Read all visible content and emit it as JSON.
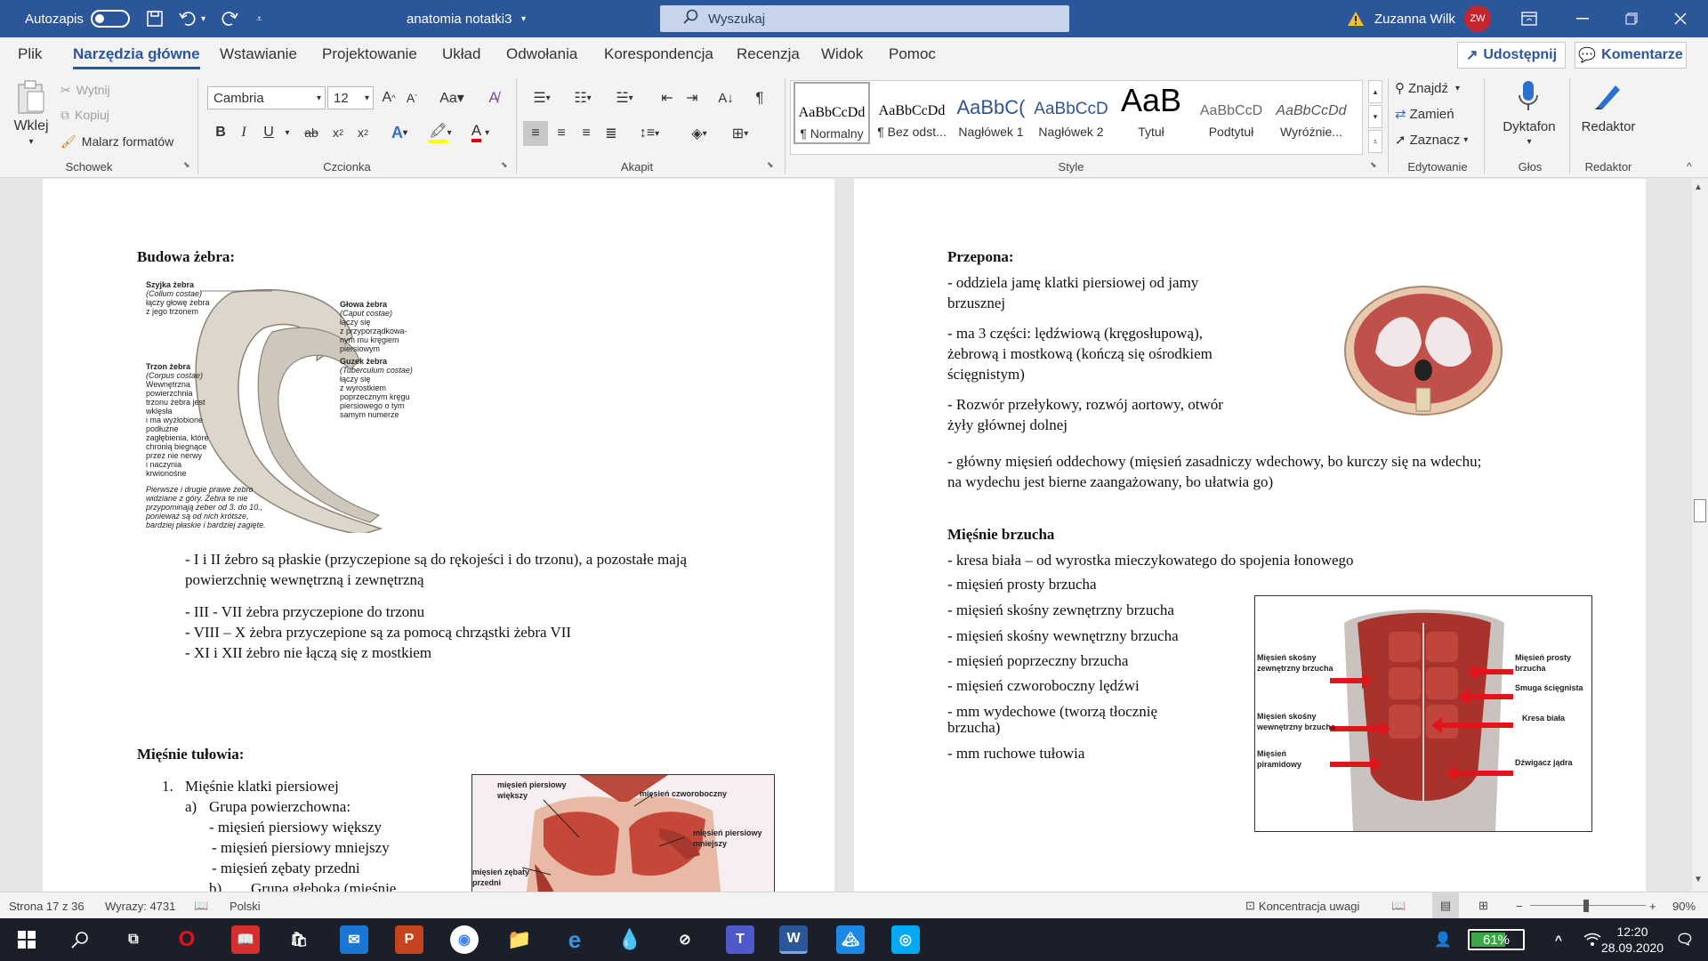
{
  "titlebar": {
    "autosave_label": "Autozapis",
    "doc_title": "anatomia notatki3",
    "search_placeholder": "Wyszukaj",
    "user_name": "Zuzanna Wilk",
    "user_initials": "ZW"
  },
  "menu": {
    "tabs": [
      "Plik",
      "Narzędzia główne",
      "Wstawianie",
      "Projektowanie",
      "Układ",
      "Odwołania",
      "Korespondencja",
      "Recenzja",
      "Widok",
      "Pomoc"
    ],
    "share": "Udostępnij",
    "comments": "Komentarze"
  },
  "ribbon": {
    "clipboard": {
      "paste": "Wklej",
      "cut": "Wytnij",
      "copy": "Kopiuj",
      "format_painter": "Malarz formatów",
      "label": "Schowek"
    },
    "font": {
      "name": "Cambria",
      "size": "12",
      "label": "Czcionka"
    },
    "paragraph": {
      "label": "Akapit"
    },
    "styles": {
      "label": "Style",
      "items": [
        {
          "preview": "AaBbCcDd",
          "name": "¶ Normalny"
        },
        {
          "preview": "AaBbCcDd",
          "name": "¶ Bez odst..."
        },
        {
          "preview": "AaBbC(",
          "name": "Nagłówek 1"
        },
        {
          "preview": "AaBbCcD",
          "name": "Nagłówek 2"
        },
        {
          "preview": "AaB",
          "name": "Tytuł"
        },
        {
          "preview": "AaBbCcD",
          "name": "Podtytuł"
        },
        {
          "preview": "AaBbCcDd",
          "name": "Wyróżnie..."
        }
      ]
    },
    "editing": {
      "find": "Znajdź",
      "replace": "Zamień",
      "select": "Zaznacz",
      "label": "Edytowanie"
    },
    "voice": {
      "dictate": "Dyktafon",
      "label": "Głos"
    },
    "editor": {
      "name": "Redaktor",
      "label": "Redaktor"
    }
  },
  "left_page": {
    "heading1": "Budowa żebra:",
    "rib_figure": {
      "neck_title": "Szyjka żebra",
      "neck_latin": "(Collum costae)",
      "neck_desc1": "łączy głowę żebra",
      "neck_desc2": "z jego trzonem",
      "head_title": "Głowa żebra",
      "head_latin": "(Caput costae)",
      "head_desc": [
        "łączy się",
        "z przyporządkowa-",
        "nym mu kręgiem",
        "piersiowym"
      ],
      "tubercle_title": "Guzek żebra",
      "tubercle_latin": "(Tuberculum costae)",
      "tubercle_desc": [
        "łączy się",
        "z wyrostkiem",
        "poprzecznym kręgu",
        "piersiowego o tym",
        "samym numerze"
      ],
      "body_title": "Trzon żebra",
      "body_latin": "(Corpus costae)",
      "body_desc": [
        "Wewnętrzna",
        "powierzchnia",
        "trzonu żebra jest",
        "wklęsła",
        "i ma wyżłobione",
        "podłużne",
        "zagłębienia, które",
        "chronią biegnące",
        "przez nie nerwy",
        "i naczynia",
        "krwionośne"
      ],
      "caption": [
        "Pierwsze i drugie prawe żebro",
        "widziane z góry. Żebra te nie",
        "przypominają żeber od 3. do 10.,",
        "ponieważ są od nich krótsze,",
        "bardziej płaskie i bardziej zagięte."
      ]
    },
    "p1_line1": "- I i II żebro są płaskie (przyczepione są do rękojeści i do trzonu), a pozostałe mają",
    "p1_line2": "powierzchnię wewnętrzną i zewnętrzną",
    "p2": "- III - VII żebra przyczepione do trzonu",
    "p3": "- VIII – X żebra przyczepione są za pomocą chrząstki żebra VII",
    "p4": "- XI i XII żebro nie łączą się z mostkiem",
    "heading2": "Mięśnie tułowia:",
    "list_num": "1.",
    "list1": "Mięśnie klatki piersiowej",
    "sub_a": "a)",
    "sub_a_text": "Grupa powierzchowna:",
    "a1": "- mięsień piersiowy większy",
    "a2": "- mięsień piersiowy mniejszy",
    "a3": "- mięsień zębaty przedni",
    "sub_b": "b)",
    "sub_b_text": "Grupa       głęboka       (mięśnie",
    "chest_figure": {
      "l1": "mięsień piersiowy",
      "l2": "większy",
      "l3": "mięsień czworoboczny",
      "l4": "mięsień piersiowy",
      "l5": "mniejszy",
      "l6": "mięsień zębaty",
      "l7": "przedni"
    }
  },
  "right_page": {
    "heading1": "Przepona:",
    "d1_line1": " - oddziela jamę klatki piersiowej od jamy",
    "d1_line2": "brzusznej",
    "d2_line1": " - ma 3 części: lędźwiową (kręgosłupową),",
    "d2_line2": "żebrową i mostkową (kończą się ośrodkiem",
    "d2_line3": "ścięgnistym)",
    "d3_line1": " - Rozwór przełykowy, rozwój aortowy, otwór",
    "d3_line2": "żyły głównej dolnej",
    "d4_line1": " - główny mięsień oddechowy (mięsień zasadniczy wdechowy, bo kurczy się na wdechu;",
    "d4_line2": "na wydechu jest bierne zaangażowany, bo ułatwia go)",
    "heading2": "Mięśnie brzucha",
    "m1": " - kresa biała – od wyrostka mieczykowatego do spojenia łonowego",
    "m2": " - mięsień prosty brzucha",
    "m3": " - mięsień skośny zewnętrzny brzucha",
    "m4": "- mięsień skośny wewnętrzny brzucha",
    "m5": " - mięsień poprzeczny brzucha",
    "m6": " - mięsień czworoboczny lędźwi",
    "m7_line1": " - mm wydechowe (tworzą tłocznię",
    "m7_line2": "brzucha)",
    "m8": " - mm ruchowe tułowia",
    "abs_figure": {
      "l1": "Mięsień skośny",
      "l2": "zewnętrzny brzucha",
      "l3": "Mięsień skośny",
      "l4": "wewnętrzny brzucha",
      "l5": "Mięsień",
      "l6": "piramidowy",
      "r1": "Mięsień prosty",
      "r2": "brzucha",
      "r3": "Smuga ścięgnista",
      "r4": "Kresa biała",
      "r5": "Dźwigacz jądra"
    }
  },
  "status": {
    "page": "Strona 17 z 36",
    "words": "Wyrazy: 4731",
    "lang": "Polski",
    "focus": "Koncentracja uwagi",
    "zoom": "90%"
  },
  "taskbar": {
    "battery": "61%",
    "time": "12:20",
    "date": "28.09.2020"
  },
  "colors": {
    "word_blue": "#2b579a",
    "muscle_red": "#b5302c",
    "arrow_red": "#e0141b"
  }
}
